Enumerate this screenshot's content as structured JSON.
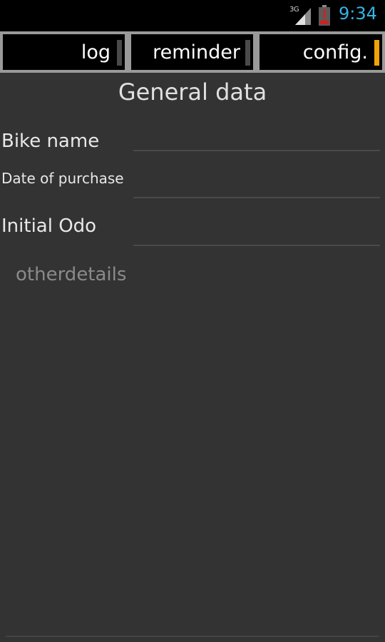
{
  "status_bar": {
    "network": "3G",
    "time": "9:34",
    "icons": [
      "signal-icon",
      "battery-alert-icon"
    ],
    "time_color": "#33b5e5",
    "battery_alert_color": "#cc2222"
  },
  "tabs": [
    {
      "label": "log",
      "active": false
    },
    {
      "label": "reminder",
      "active": false
    },
    {
      "label": "config.",
      "active": true
    }
  ],
  "tab_accent_color": "#f0a30a",
  "page_title": "General data",
  "fields": {
    "bike_name": {
      "label": "Bike name",
      "value": ""
    },
    "date_of_purchase": {
      "label": "Date of purchase",
      "value": ""
    },
    "initial_odo": {
      "label": "Initial Odo",
      "value": ""
    }
  },
  "other_details": {
    "placeholder": "otherdetails",
    "value": ""
  }
}
